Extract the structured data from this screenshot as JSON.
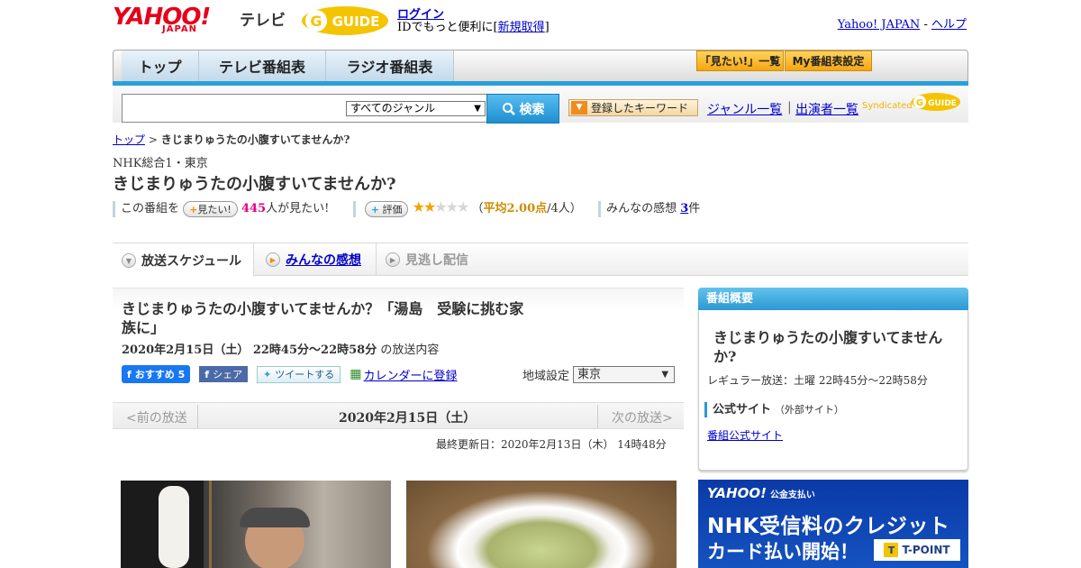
{
  "header": {
    "logo_text": "YAHOO!",
    "logo_sub": "JAPAN",
    "tv_label": "テレビ",
    "gguide_text": "GUIDE",
    "login_label": "ログイン",
    "login_sub_prefix": "IDでもっと便利に[",
    "signup_label": "新規取得",
    "login_sub_suffix": "]",
    "yj_label": "Yahoo! JAPAN",
    "yj_sep": " - ",
    "help_label": "ヘルプ"
  },
  "nav": {
    "tabs": [
      "トップ",
      "テレビ番組表",
      "ラジオ番組表"
    ],
    "want_list_label": "「見たい!」一覧",
    "my_schedule_label": "My番組表設定"
  },
  "search": {
    "placeholder": "",
    "genre_selected": "すべてのジャンル",
    "button_label": "検索",
    "keyword_button_label": "登録したキーワード",
    "genre_list_label": "ジャンル一覧",
    "sep": "|",
    "cast_list_label": "出演者一覧",
    "syndicated_label": "Syndicated"
  },
  "breadcrumb": {
    "top_label": "トップ",
    "sep": " > ",
    "current": "きじまりゅうたの小腹すいてませんか?"
  },
  "program": {
    "channel": "NHK総合1・東京",
    "title": "きじまりゅうたの小腹すいてませんか?",
    "want_prefix": "この番組を",
    "want_pill": "見たい!",
    "want_count": "445",
    "want_suffix": "人が見たい!",
    "rating_pill": "評価",
    "rating_value": 2.0,
    "rating_max": 5,
    "rating_avg_prefix": "（",
    "rating_avg": "平均2.00点",
    "rating_suffix": "/4人）",
    "review_prefix": "みんなの感想",
    "review_count": "3",
    "review_suffix": "件"
  },
  "tabs": {
    "schedule": "放送スケジュール",
    "reviews": "みんなの感想",
    "missed": "見逃し配信"
  },
  "episode": {
    "title": "きじまりゅうたの小腹すいてませんか？「湯島　受験に挑む家族に」",
    "datetime": "2020年2月15日（土）  22時45分～22時58分",
    "datetime_suffix": "の放送内容",
    "fb_label": "おすすめ 5",
    "share_label": "シェア",
    "tweet_label": "ツイートする",
    "calendar_label": "カレンダーに登録",
    "region_label": "地域設定",
    "region_selected": "東京",
    "prev_label": "<前の放送",
    "date_label": "2020年2月15日（土）",
    "next_label": "次の放送>",
    "updated": "最終更新日：2020年2月13日（木） 14時48分"
  },
  "side": {
    "head": "番組概要",
    "title": "きじまりゅうたの小腹すいてませんか?",
    "regular": "レギュラー放送：土曜 22時45分～22時58分",
    "official_label": "公式サイト",
    "official_note": "（外部サイト）",
    "official_link": "番組公式サイト"
  },
  "ad": {
    "brand": "YAHOO!",
    "brand_sub": "公金支払い",
    "line1": "NHK受信料のクレジット",
    "line2": "カード払い開始！",
    "tpoint": "T-POINT"
  },
  "colors": {
    "accent_blue": "#2aa0d8",
    "link": "#0000cc",
    "star_on": "#f2a400",
    "want_count": "#e0007f"
  }
}
